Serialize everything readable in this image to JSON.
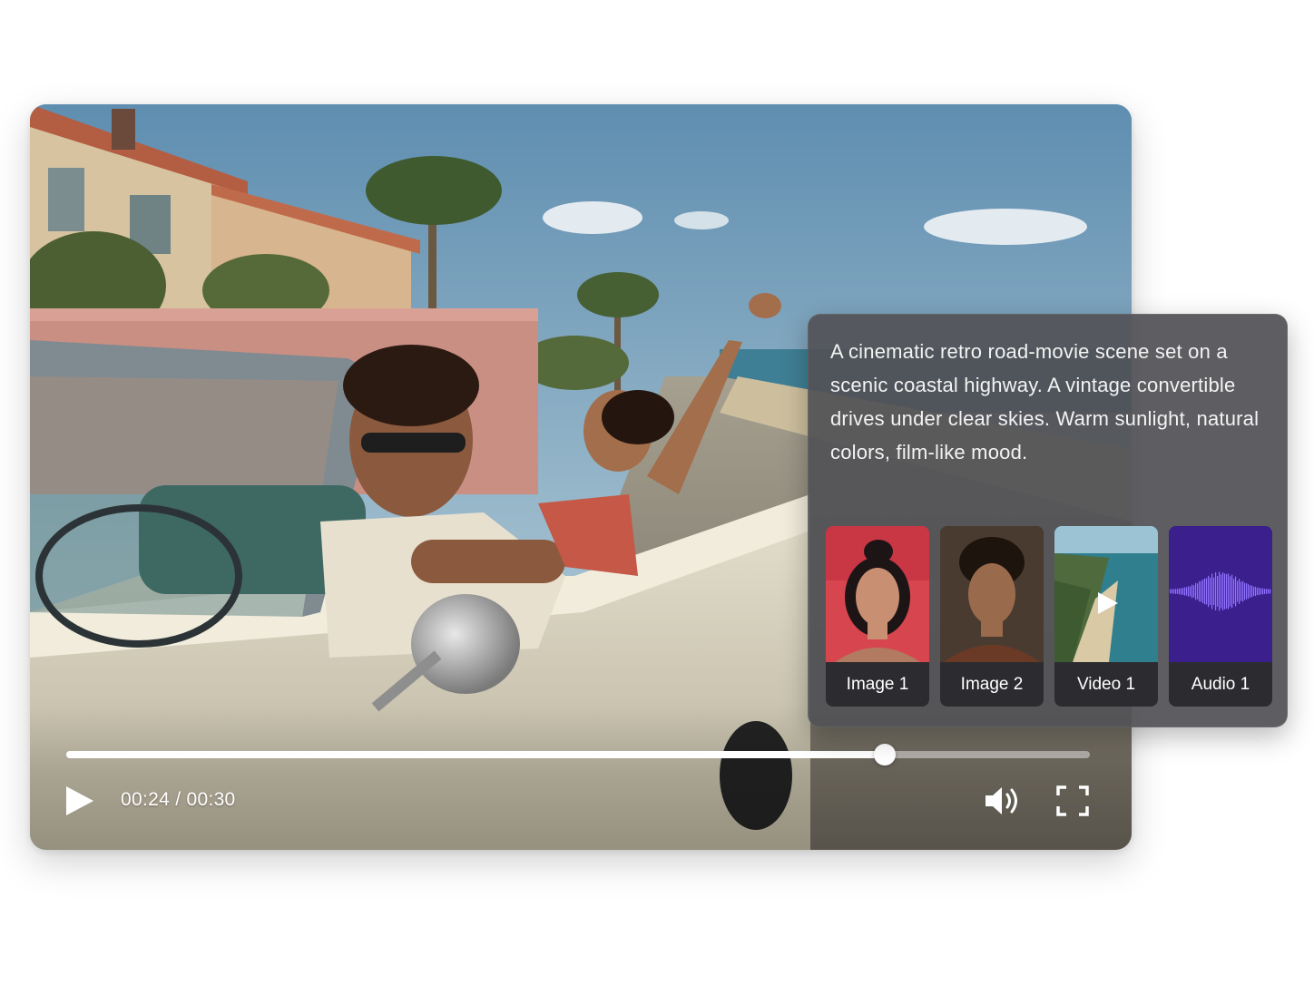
{
  "player": {
    "current_time": "00:24",
    "separator": "/",
    "duration": "00:30",
    "progress_fraction": 0.8,
    "time_display": "00:24 / 00:30"
  },
  "prompt_panel": {
    "description": "A cinematic retro road-movie scene set on a scenic coastal highway. A vintage convertible drives under clear skies. Warm sunlight, natural colors, film-like mood."
  },
  "assets": [
    {
      "label": "Image 1",
      "kind": "image"
    },
    {
      "label": "Image 2",
      "kind": "image"
    },
    {
      "label": "Video 1",
      "kind": "video"
    },
    {
      "label": "Audio 1",
      "kind": "audio"
    }
  ],
  "icons": {
    "play": "play-icon",
    "volume": "volume-icon",
    "fullscreen": "fullscreen-icon"
  },
  "colors": {
    "panel_bg": "#525256",
    "audio_tile": "#3b1f8c",
    "waveform": "#8f72ff"
  }
}
